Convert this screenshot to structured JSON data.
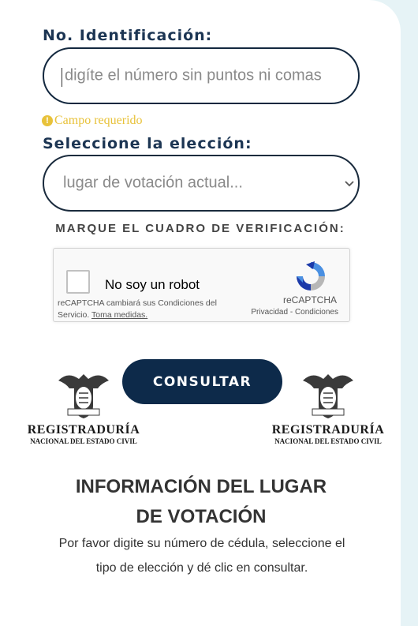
{
  "form": {
    "id_label": "No. Identificación:",
    "id_placeholder": "digíte el número sin puntos ni comas",
    "id_value": "",
    "required_msg": "Campo requerido",
    "election_label": "Seleccione la elección:",
    "election_selected": "lugar de votación actual...",
    "verify_title": "MARQUE EL CUADRO DE VERIFICACIÓN:"
  },
  "recaptcha": {
    "checkbox_label": "No soy un robot",
    "note_text": "reCAPTCHA cambiará sus Condiciones del Servicio.",
    "note_link": "Toma medidas.",
    "brand": "reCAPTCHA",
    "privacy": "Privacidad",
    "separator": " - ",
    "terms": "Condiciones"
  },
  "actions": {
    "consult_label": "CONSULTAR"
  },
  "logos": [
    {
      "name": "REGISTRADURÍA",
      "subtitle": "NACIONAL DEL ESTADO CIVIL",
      "icon": "national-shield-icon"
    },
    {
      "name": "REGISTRADURÍA",
      "subtitle": "NACIONAL DEL ESTADO CIVIL",
      "icon": "national-shield-icon"
    }
  ],
  "info": {
    "title_line1": "INFORMACIÓN DEL LUGAR",
    "title_line2": "DE VOTACIÓN",
    "text_line1": "Por favor digite su número de cédula, seleccione el",
    "text_line2": "tipo de elección y dé clic en consultar."
  },
  "colors": {
    "navy": "#0d2a4a",
    "label": "#1c3553",
    "warning": "#e8c23a",
    "background": "#e6f3f6"
  }
}
